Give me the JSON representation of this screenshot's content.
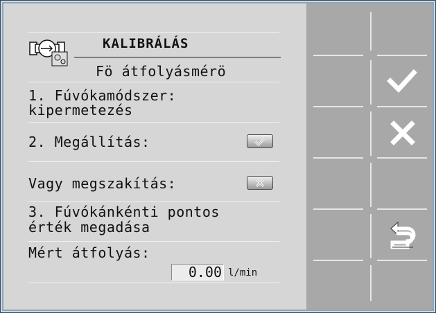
{
  "title": "KALIBRÁLÁS",
  "subtitle": "Fö átfolyásmérö",
  "step1": {
    "line1": "1. Fúvókamódszer:",
    "line2": "kipermetezés"
  },
  "step2": {
    "label": "2. Megállítás:",
    "icon": "check-icon"
  },
  "abort": {
    "label": "Vagy megszakítás:",
    "icon": "close-icon"
  },
  "step3": {
    "line1": "3. Fúvókánkénti pontos",
    "line2": "érték megadása"
  },
  "flow": {
    "label": "Mért átfolyás:",
    "value": "0.00",
    "unit": "l/min"
  },
  "sidebar": {
    "buttons": [
      {
        "name": "confirm",
        "icon": "check-icon"
      },
      {
        "name": "cancel",
        "icon": "close-icon"
      },
      {
        "name": "back",
        "icon": "return-arrow-icon"
      }
    ]
  },
  "colors": {
    "main_bg": "#d6d6d6",
    "side_bg": "#a8a8a8",
    "frame": "#2a4a6a"
  }
}
